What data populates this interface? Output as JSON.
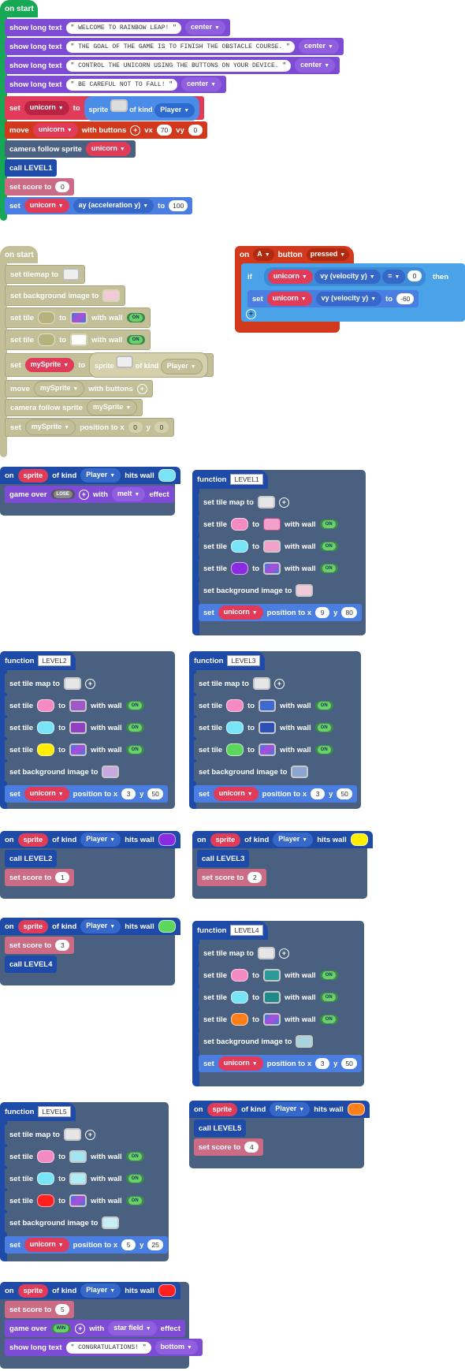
{
  "on_start_1": {
    "hat": "on start",
    "show_long_text": "show long text",
    "texts": [
      "WELCOME TO RAINBOW LEAP!",
      "THE GOAL OF THE GAME IS TO FINISH THE OBSTACLE COURSE.",
      "CONTROL THE UNICORN USING THE BUTTONS ON YOUR DEVICE.",
      "BE CAREFUL NOT TO FALL!"
    ],
    "align": "center",
    "set": "set",
    "unicorn": "unicorn",
    "to": "to",
    "sprite": "sprite",
    "of_kind": "of kind",
    "player": "Player",
    "move": "move",
    "with_buttons": "with buttons",
    "vx": "vx",
    "vx_val": "70",
    "vy": "vy",
    "vy_val": "0",
    "camera": "camera follow sprite",
    "call": "call LEVEL1",
    "set_score": "set score to",
    "score_val": "0",
    "ay": "ay (acceleration y)",
    "ay_val": "100"
  },
  "on_start_2": {
    "hat": "on start",
    "set_tilemap": "set tilemap to",
    "set_bg": "set background image to",
    "set_tile": "set tile",
    "to": "to",
    "with_wall": "with wall",
    "on": "ON",
    "set": "set",
    "mysprite": "mySprite",
    "sprite": "sprite",
    "of_kind": "of kind",
    "player": "Player",
    "move": "move",
    "with_buttons": "with buttons",
    "camera": "camera follow sprite",
    "position": "position to x",
    "x": "0",
    "y_label": "y",
    "y": "0"
  },
  "on_a": {
    "on": "on",
    "button": "A",
    "pressed": "button",
    "event": "pressed",
    "if": "if",
    "unicorn": "unicorn",
    "vy": "vy (velocity y)",
    "op": "=",
    "cmp": "0",
    "then": "then",
    "set": "set",
    "to": "to",
    "val": "-60"
  },
  "hits": {
    "on": "on",
    "sprite": "sprite",
    "of_kind": "of kind",
    "player": "Player",
    "hits_wall": "hits wall",
    "game_over": "game over",
    "lose": "LOSE",
    "win": "WIN",
    "with": "with",
    "melt": "melt",
    "star_field": "star field",
    "effect": "effect",
    "call2": "call LEVEL2",
    "call3": "call LEVEL3",
    "call4": "call LEVEL4",
    "call5": "call LEVEL5",
    "set_score": "set score to",
    "s1": "1",
    "s2": "2",
    "s3": "3",
    "s4": "4",
    "s5": "5",
    "show_long_text": "show long text",
    "congrats": "CONGRATULATIONS!",
    "bottom": "bottom"
  },
  "functions": {
    "function": "function",
    "set_tile_map": "set tile map to",
    "set_tile": "set tile",
    "to": "to",
    "with_wall": "with wall",
    "on": "ON",
    "set_bg": "set background image to",
    "set": "set",
    "unicorn": "unicorn",
    "position": "position to x",
    "y_label": "y",
    "levels": [
      {
        "name": "LEVEL1",
        "x": "9",
        "y": "80"
      },
      {
        "name": "LEVEL2",
        "x": "3",
        "y": "50"
      },
      {
        "name": "LEVEL3",
        "x": "3",
        "y": "50"
      },
      {
        "name": "LEVEL4",
        "x": "3",
        "y": "50"
      },
      {
        "name": "LEVEL5",
        "x": "5",
        "y": "25"
      }
    ]
  },
  "colors": {
    "events": "#17a855",
    "text": "#7e4bd4",
    "sprites": "#e03c5a",
    "controller": "#d2391c",
    "scene": "#4a6080",
    "functions": "#1e4aa8",
    "info": "#cb6b86",
    "logic": "#4aa3e8",
    "disabled": "#c3c099"
  }
}
